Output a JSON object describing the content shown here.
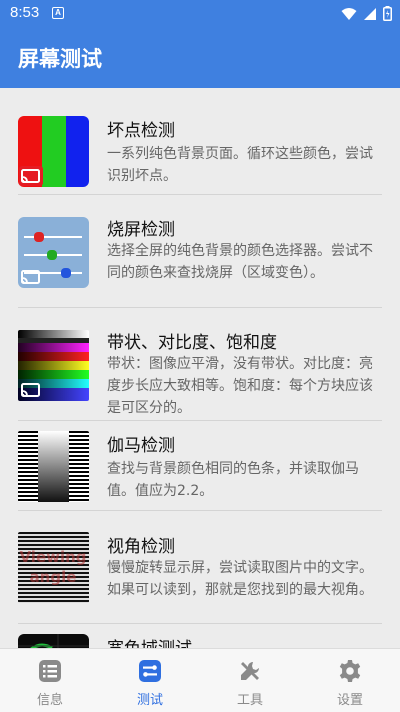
{
  "status": {
    "time": "8:53",
    "notif": "A"
  },
  "app": {
    "title": "屏幕测试"
  },
  "items": [
    {
      "title": "坏点检测",
      "desc": "一系列纯色背景页面。循环这些颜色，尝试识别坏点。",
      "icon": "color-bars-thumbnail"
    },
    {
      "title": "烧屏检测",
      "desc": "选择全屏的纯色背景的颜色选择器。尝试不同的颜色来查找烧屏（区域变色）。",
      "icon": "sliders-thumbnail"
    },
    {
      "title": "带状、对比度、饱和度",
      "desc": "带状：图像应平滑，没有带状。对比度：亮度步长应大致相等。饱和度：每个方块应该是可区分的。",
      "icon": "gradient-palette-thumbnail"
    },
    {
      "title": "伽马检测",
      "desc": "查找与背景颜色相同的色条，并读取伽马值。值应为2.2。",
      "icon": "gamma-stripes-thumbnail"
    },
    {
      "title": "视角检测",
      "desc": "慢慢旋转显示屏，尝试读取图片中的文字。如果可以读到，那就是您找到的最大视角。",
      "icon": "viewing-angle-thumbnail",
      "thumb_text": [
        "Viewing",
        "angle"
      ]
    },
    {
      "title": "宽色域测试",
      "desc": "",
      "icon": "gamut-thumbnail"
    }
  ],
  "nav": [
    {
      "label": "信息",
      "icon": "list-icon",
      "active": false
    },
    {
      "label": "测试",
      "icon": "toggle-icon",
      "active": true
    },
    {
      "label": "工具",
      "icon": "tools-icon",
      "active": false
    },
    {
      "label": "设置",
      "icon": "gear-icon",
      "active": false
    }
  ],
  "colors": {
    "primary": "#3f80e0",
    "nav_active": "#2f6fe0",
    "nav_inactive": "#8a8a8a"
  }
}
